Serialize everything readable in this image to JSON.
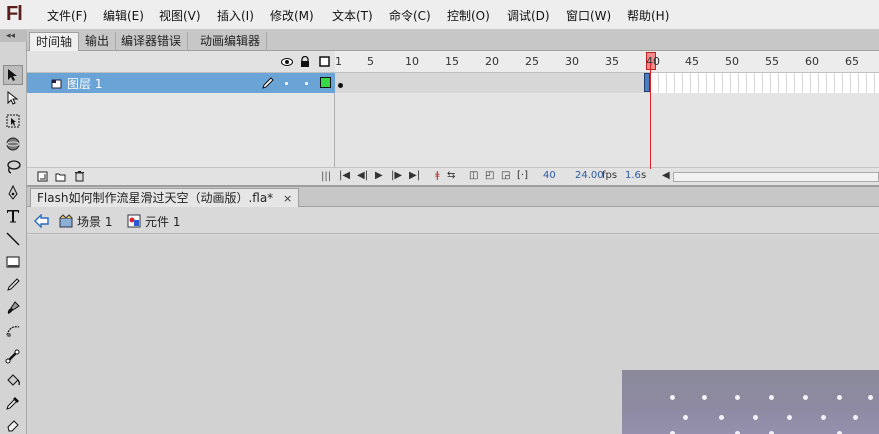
{
  "app": {
    "logo": "Fl"
  },
  "menu": [
    "文件(F)",
    "编辑(E)",
    "视图(V)",
    "插入(I)",
    "修改(M)",
    "文本(T)",
    "命令(C)",
    "控制(O)",
    "调试(D)",
    "窗口(W)",
    "帮助(H)"
  ],
  "panel_tabs": [
    "时间轴",
    "输出",
    "编译器错误",
    "动画编辑器"
  ],
  "timeline": {
    "layer_name": "图层 1",
    "ruler_labels": [
      "1",
      "5",
      "10",
      "15",
      "20",
      "25",
      "30",
      "35",
      "40",
      "45",
      "50",
      "55",
      "60",
      "65"
    ],
    "playhead_frame": "40",
    "current_frame": "40",
    "fps_value": "24.00",
    "fps_unit": "fps",
    "elapsed_value": "1.6",
    "elapsed_unit": "s"
  },
  "document": {
    "tab_title": "Flash如何制作流星滑过天空（动画版）.fla*",
    "close_glyph": "×"
  },
  "breadcrumb": {
    "scene": "场景 1",
    "symbol": "元件 1"
  },
  "colors": {
    "layer_selected": "#6aa3d6",
    "playhead": "#e02020",
    "keyframe_fill": "#d7d7d7"
  },
  "icons": [
    "eye-icon",
    "lock-icon",
    "outline-icon",
    "pencil-icon",
    "new-layer-icon",
    "new-folder-icon",
    "trash-icon",
    "back-arrow-icon",
    "scene-icon",
    "symbol-icon"
  ]
}
